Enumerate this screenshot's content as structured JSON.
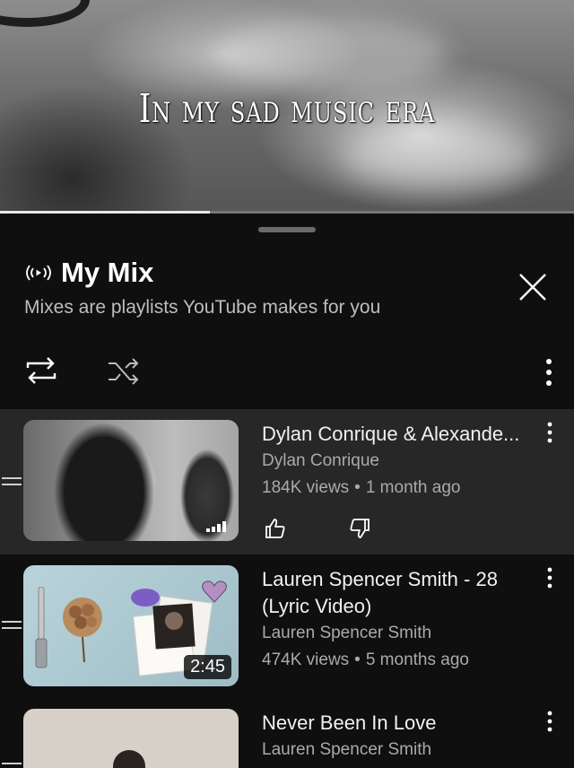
{
  "player": {
    "overlay_text": "In my sad music era",
    "progress": 0.365
  },
  "mix": {
    "title": "My Mix",
    "subtitle": "Mixes are playlists YouTube makes for you",
    "icons": {
      "mix": "radio-broadcast-icon",
      "close": "close-icon",
      "repeat": "repeat-icon",
      "shuffle": "shuffle-icon",
      "more": "more-vertical-icon"
    }
  },
  "playlist": [
    {
      "title": "Dylan Conrique & Alexande...",
      "channel": "Dylan Conrique",
      "views": "184K views",
      "age": "1 month ago",
      "duration": "",
      "active": true
    },
    {
      "title": "Lauren Spencer Smith - 28 (Lyric Video)",
      "channel": "Lauren Spencer Smith",
      "views": "474K views",
      "age": "5 months ago",
      "duration": "2:45",
      "active": false
    },
    {
      "title": "Never Been In Love",
      "channel": "Lauren Spencer Smith",
      "views": "",
      "age": "",
      "duration": "",
      "active": false
    }
  ],
  "separator": "•",
  "colors": {
    "background": "#0f0f0f",
    "active_row": "#272727",
    "secondary_text": "#aaaaaa"
  }
}
